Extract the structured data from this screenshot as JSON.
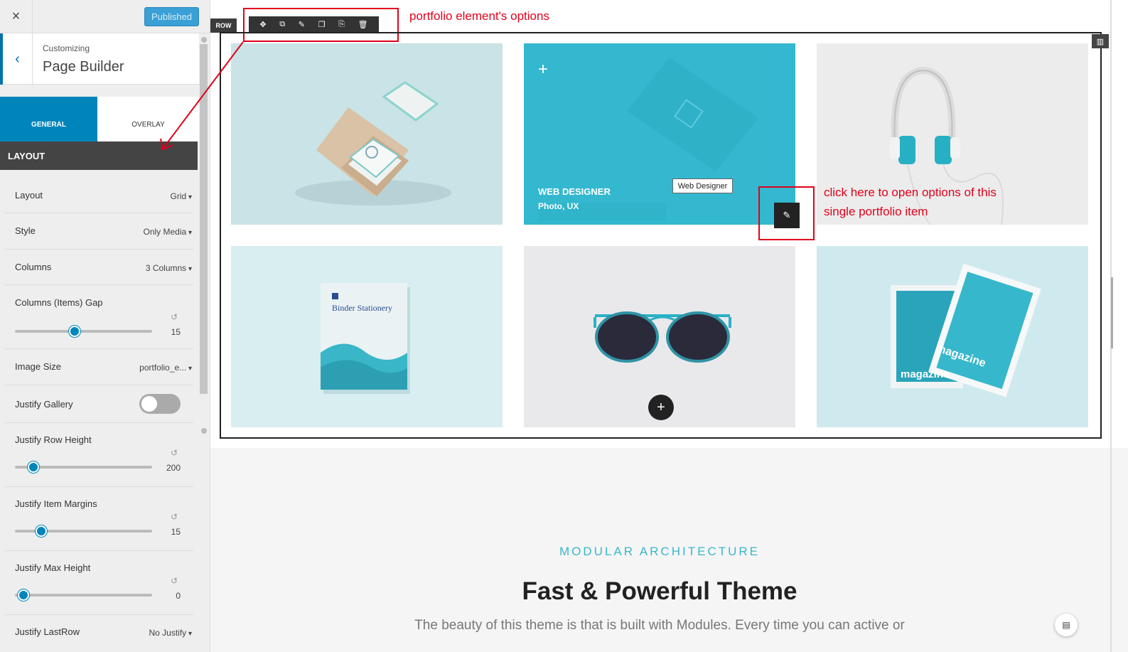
{
  "sidebar": {
    "close_icon": "×",
    "published_label": "Published",
    "back_icon": "‹",
    "customizing_label": "Customizing",
    "title": "Page Builder",
    "tabs": [
      {
        "label": "GENERAL",
        "active": true
      },
      {
        "label": "OVERLAY",
        "active": false
      }
    ],
    "section_title": "LAYOUT",
    "fields": {
      "layout": {
        "label": "Layout",
        "value": "Grid"
      },
      "style": {
        "label": "Style",
        "value": "Only Media"
      },
      "columns": {
        "label": "Columns",
        "value": "3 Columns"
      },
      "columns_gap": {
        "label": "Columns (Items) Gap",
        "value": "15"
      },
      "image_size": {
        "label": "Image Size",
        "value": "portfolio_e..."
      },
      "justify_gallery": {
        "label": "Justify Gallery",
        "enabled": false
      },
      "justify_row_height": {
        "label": "Justify Row Height",
        "value": "200"
      },
      "justify_item_margins": {
        "label": "Justify Item Margins",
        "value": "15"
      },
      "justify_max_height": {
        "label": "Justify Max Height",
        "value": "0"
      },
      "justify_lastrow": {
        "label": "Justify LastRow",
        "value": "No Justify"
      }
    },
    "accent_color": "#0085ba"
  },
  "builder": {
    "row_badge": "ROW",
    "toolbar_icons": [
      "move-icon",
      "copy-icon",
      "brush-icon",
      "paste-icon",
      "clone-icon",
      "trash-icon"
    ],
    "toolbar_glyphs": [
      "✥",
      "⧉",
      "✎",
      "❐",
      "⎘",
      "🗑"
    ],
    "column_icon": "▥"
  },
  "annotations": {
    "element_options": "portfolio element's options",
    "item_options_line1": "click here to open options of this",
    "item_options_line2": "single portfolio item",
    "color": "#e3001b"
  },
  "portfolio": {
    "hover_item": {
      "plus": "+",
      "title": "WEB DESIGNER",
      "subtitle": "Photo, UX",
      "tooltip": "Web Designer"
    },
    "edit_icon": "✎",
    "add_icon": "+",
    "binder_title": "Binder Stationery",
    "magazine_label": "magazine"
  },
  "section": {
    "kicker": "MODULAR ARCHITECTURE",
    "headline": "Fast & Powerful Theme",
    "description": "The beauty of this theme is that is built with Modules. Every time you can active or",
    "kicker_color": "#3bb7c9"
  },
  "doc_icon": "▤"
}
